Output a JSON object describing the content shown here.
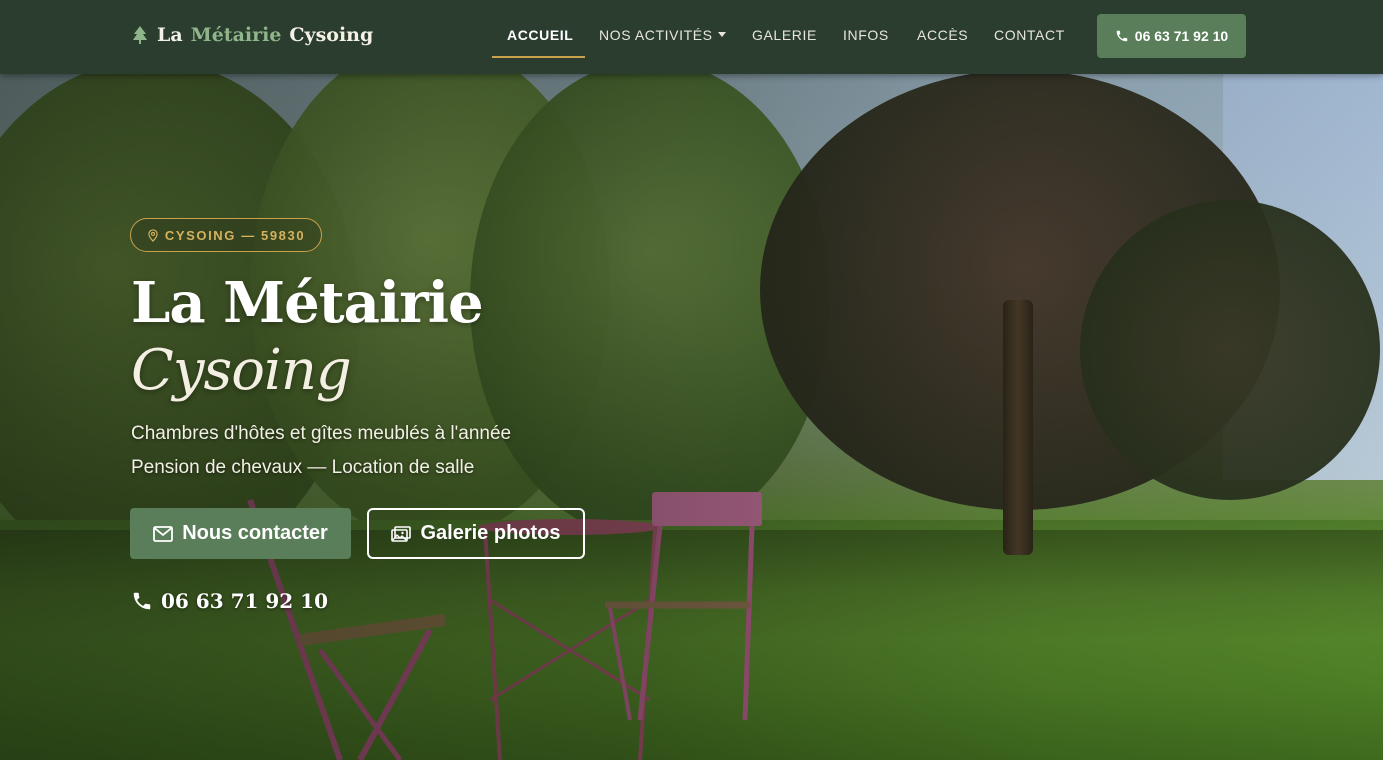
{
  "brand": {
    "word1": "La",
    "word2": "Métairie",
    "word3": "Cysoing"
  },
  "nav": {
    "items": [
      {
        "label": "ACCUEIL",
        "active": true
      },
      {
        "label": "NOS ACTIVITÉS",
        "dropdown": true
      },
      {
        "label": "GALERIE"
      },
      {
        "label": "INFOS"
      },
      {
        "label": "ACCÈS"
      },
      {
        "label": "CONTACT"
      }
    ],
    "phone": "06 63 71 92 10"
  },
  "hero": {
    "badge": "CYSOING — 59830",
    "title_line1": "La Métairie",
    "title_line2": "Cysoing",
    "subtitle_line1": "Chambres d'hôtes et gîtes meublés à l'année",
    "subtitle_line2": "Pension de chevaux — Location de salle",
    "btn_contact": "Nous contacter",
    "btn_gallery": "Galerie photos",
    "phone": "06 63 71 92 10"
  },
  "colors": {
    "navbar_bg": "#2b3d2f",
    "accent_green": "#5a7d5a",
    "gold": "#c9a24b",
    "brand_highlight": "#8fb58a"
  },
  "icons": {
    "brand": "tree-icon",
    "nav_phone": "phone-icon",
    "badge": "map-pin-icon",
    "contact": "envelope-icon",
    "gallery": "image-icon",
    "hero_phone": "phone-icon"
  }
}
